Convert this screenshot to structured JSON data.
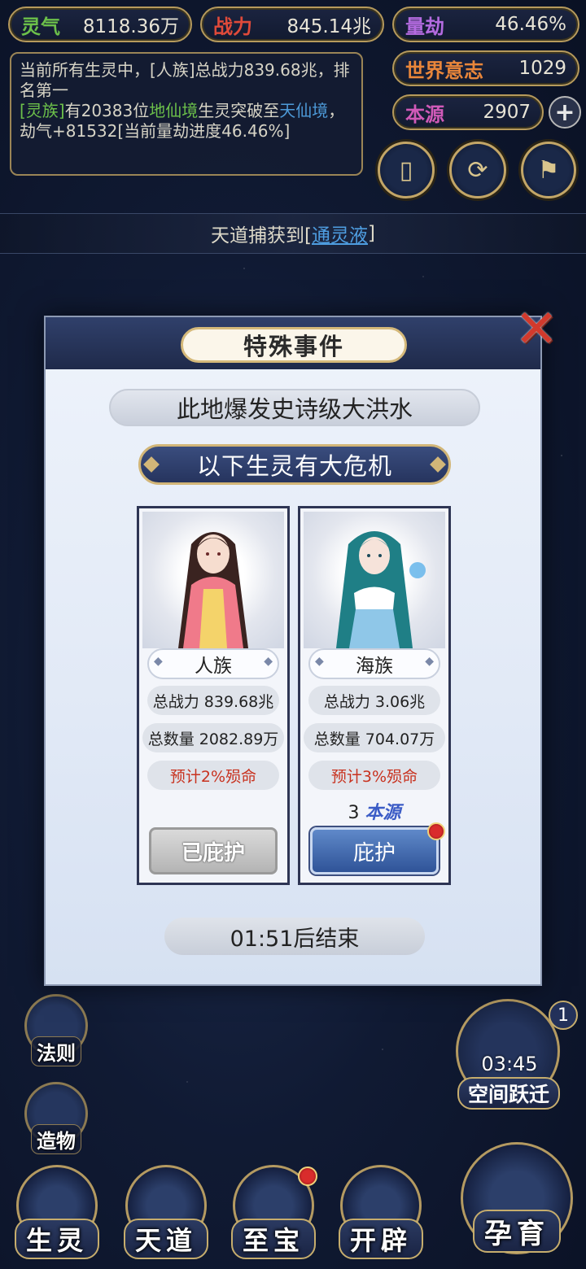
{
  "resources": {
    "lingqi": {
      "label": "灵气",
      "value": "8118.36万"
    },
    "zhanli": {
      "label": "战力",
      "value": "845.14兆"
    },
    "liangjie": {
      "label": "量劫",
      "value": "46.46%"
    },
    "world_will": {
      "label": "世界意志",
      "value": "1029"
    },
    "benyuan": {
      "label": "本源",
      "value": "2907"
    }
  },
  "log": {
    "line1": "当前所有生灵中，[人族]总战力839.68兆，排名第一",
    "line2_race": "[灵族]",
    "line2_a": "有20383位",
    "line2_realm": "地仙境",
    "line2_b": "生灵突破至",
    "line2_realm2": "天仙境",
    "line2_c": "，劫气+81532[当前量劫进度46.46%]"
  },
  "banner": {
    "prefix": "天道捕获到[",
    "item": "通灵液",
    "suffix": "]"
  },
  "side_menu": [
    {
      "label": "法则"
    },
    {
      "label": "造物"
    }
  ],
  "bottom_nav": [
    {
      "label": "生灵"
    },
    {
      "label": "天道"
    },
    {
      "label": "至宝"
    },
    {
      "label": "开辟"
    }
  ],
  "birth_button": {
    "label": "孕育"
  },
  "space_jump": {
    "time": "03:45",
    "label": "空间跃迁",
    "badge": "1"
  },
  "modal": {
    "title": "特殊事件",
    "event": "此地爆发史诗级大洪水",
    "warning": "以下生灵有大危机",
    "cards": [
      {
        "race": "人族",
        "power": "总战力 839.68兆",
        "count": "总数量 2082.89万",
        "death": "预计2%殒命",
        "button": "已庇护"
      },
      {
        "race": "海族",
        "power": "总战力 3.06兆",
        "count": "总数量 704.07万",
        "death": "预计3%殒命",
        "cost_num": "3",
        "cost_unit": "本源",
        "button": "庇护"
      }
    ],
    "timer": "01:51后结束"
  },
  "colors": {
    "gold": "#b69a5c",
    "link_blue": "#4e9de0",
    "green": "#6cc04a",
    "danger_red": "#c8321f"
  }
}
